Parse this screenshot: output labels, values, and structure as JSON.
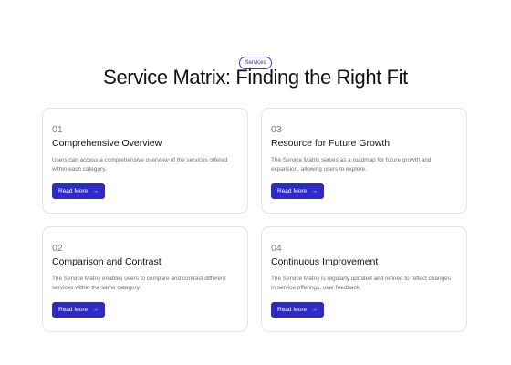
{
  "header": {
    "badge": "Services",
    "title": "Service Matrix: Finding the Right Fit"
  },
  "cards": [
    {
      "number": "01",
      "title": "Comprehensive Overview",
      "description": "Users can access a comprehensive overview of the services offered within each category.",
      "button_label": "Read More"
    },
    {
      "number": "02",
      "title": "Comparison and Contrast",
      "description": "The Service Matrix enables users to compare and contrast different services within the same category.",
      "button_label": "Read More"
    },
    {
      "number": "03",
      "title": "Resource for Future Growth",
      "description": "The Service Matrix serves as a roadmap for future growth and expansion, allowing users to explore.",
      "button_label": "Read More"
    },
    {
      "number": "04",
      "title": "Continuous Improvement",
      "description": "The Service Matrix is regularly updated and refined to reflect changes in service offerings, user feedback.",
      "button_label": "Read More"
    }
  ],
  "colors": {
    "accent": "#2e2bc4",
    "card_border": "#e3e3e3"
  },
  "icons": {
    "button_arrow": "arrow-right-icon"
  }
}
